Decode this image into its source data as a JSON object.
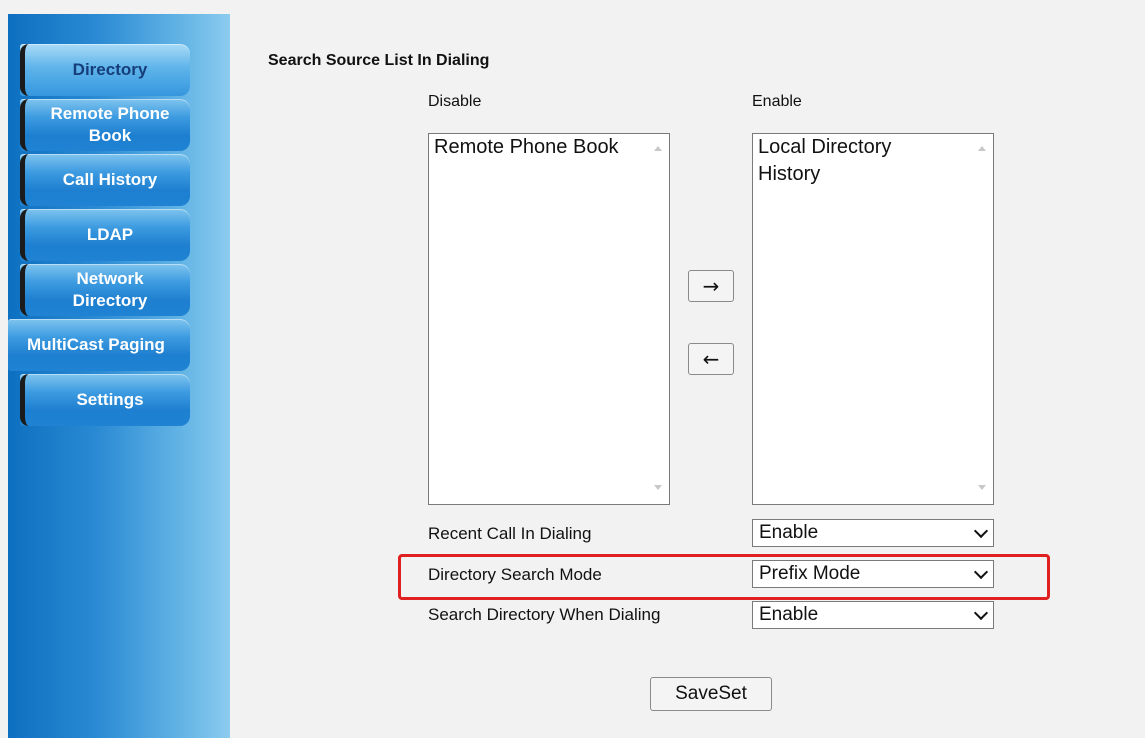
{
  "sidebar": {
    "items": [
      {
        "label": "Directory"
      },
      {
        "label": "Remote Phone\nBook"
      },
      {
        "label": "Call History"
      },
      {
        "label": "LDAP"
      },
      {
        "label": "Network\nDirectory"
      },
      {
        "label": "MultiCast Paging"
      },
      {
        "label": "Settings"
      }
    ]
  },
  "main": {
    "title": "Search Source List In Dialing",
    "disable_label": "Disable",
    "enable_label": "Enable",
    "disable_list": [
      "Remote Phone Book"
    ],
    "enable_list": [
      "Local Directory",
      "History"
    ],
    "move_right_glyph": "→",
    "move_left_glyph": "←",
    "rows": [
      {
        "label": "Recent Call In Dialing",
        "value": "Enable"
      },
      {
        "label": "Directory Search Mode",
        "value": "Prefix Mode"
      },
      {
        "label": "Search Directory When Dialing",
        "value": "Enable"
      }
    ],
    "save_label": "SaveSet"
  },
  "colors": {
    "highlight": "#e02020",
    "sidebar_blue": "#1e7fd0"
  }
}
